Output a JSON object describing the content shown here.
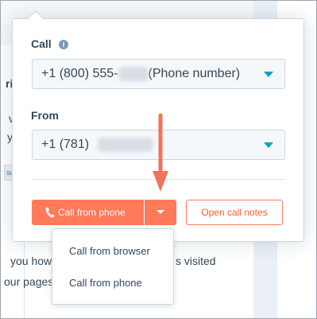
{
  "colors": {
    "accent": "#ff7a59",
    "accent_text": "#ff5c35",
    "dropdown_caret": "#00a4bd",
    "text": "#33475b",
    "annotation_arrow": "#f0735a"
  },
  "background_fragments": {
    "frag_ri": "ri",
    "frag_v": "v",
    "frag_y": "y",
    "frag_chip": "su",
    "frag_line1": "you how",
    "frag_line1_end": "s visited",
    "frag_line2": "our pages"
  },
  "call_panel": {
    "call_label": "Call",
    "info_icon": "info-icon",
    "to_select": {
      "value_prefix": "+1 (800) 555-",
      "value_suffix": "(Phone number)",
      "caret_icon": "chevron-down-icon"
    },
    "from_label": "From",
    "from_select": {
      "value_prefix": "+1 (781)",
      "caret_icon": "chevron-down-icon"
    },
    "call_button": {
      "label": "Call from phone",
      "icon": "phone-icon"
    },
    "split_toggle_icon": "caret-down-icon",
    "open_notes_button": {
      "label": "Open call notes"
    }
  },
  "call_method_menu": {
    "items": [
      {
        "label": "Call from browser"
      },
      {
        "label": "Call from phone"
      }
    ]
  },
  "annotation": {
    "icon": "arrow-down-icon"
  }
}
